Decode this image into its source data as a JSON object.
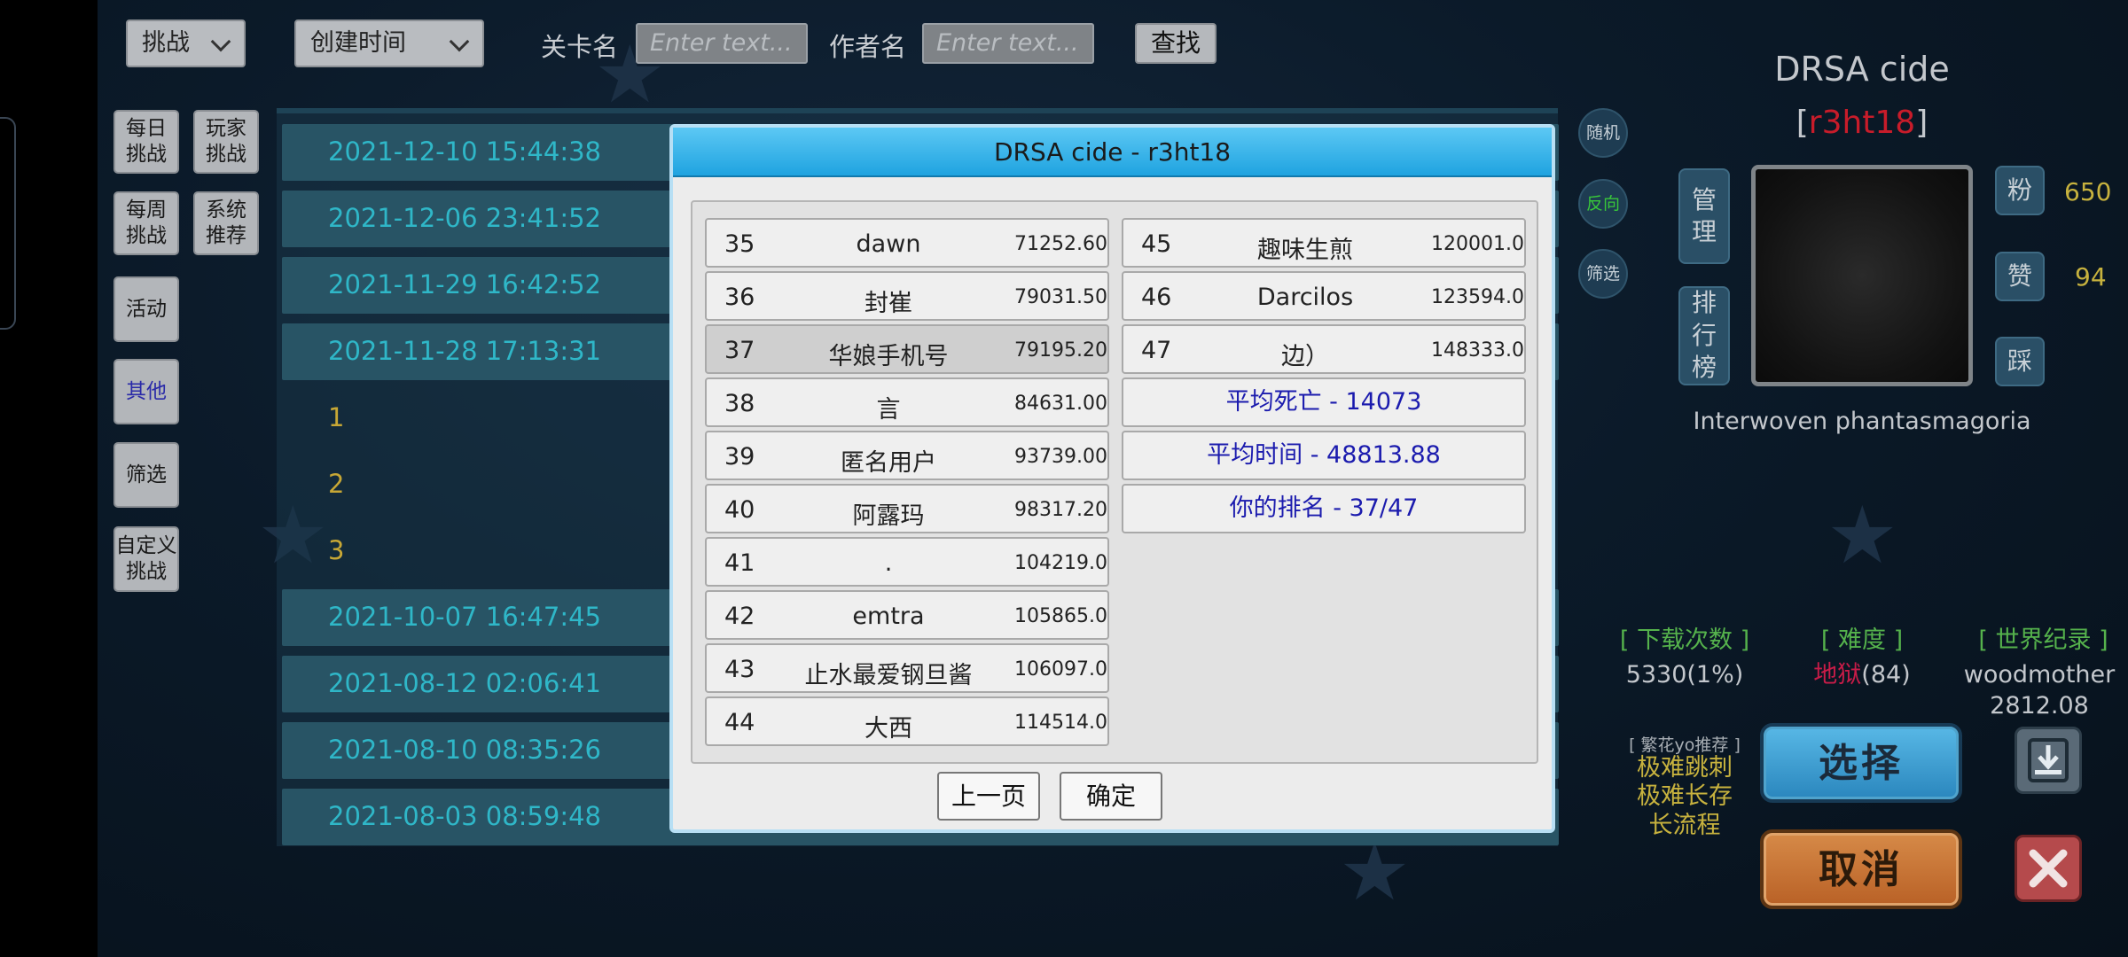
{
  "filters": {
    "type_select": "挑战",
    "sort_select": "创建时间",
    "level_name_label": "关卡名",
    "level_name_placeholder": "Enter text...",
    "author_label": "作者名",
    "author_placeholder": "Enter text...",
    "find_button": "查找"
  },
  "categories": [
    {
      "label": "每日挑战"
    },
    {
      "label": "玩家挑战"
    },
    {
      "label": "每周挑战"
    },
    {
      "label": "系统推荐"
    },
    {
      "label": "活动"
    },
    {
      "label": "其他"
    },
    {
      "label": "筛选"
    },
    {
      "label": "自定义挑战"
    }
  ],
  "list_rows": [
    "2021-12-10 15:44:38",
    "2021-12-06 23:41:52",
    "2021-11-29 16:42:52",
    "2021-11-28 17:13:31",
    "1",
    "2",
    "3",
    "2021-10-07 16:47:45",
    "2021-08-12 02:06:41",
    "2021-08-10 08:35:26",
    "2021-08-03 08:59:48"
  ],
  "side_round_buttons": [
    "随机",
    "反向",
    "筛选"
  ],
  "level": {
    "title": "DRSA cide",
    "author_open": "[",
    "author": "r3ht18",
    "author_close": "]",
    "manage_button": "管理",
    "leaderboard_button": "排行榜",
    "fans_label": "粉",
    "fans_value": "650",
    "likes_label": "赞",
    "likes_value": "94",
    "dislike_label": "踩",
    "description": "Interwoven phantasmagoria",
    "downloads_head": "[ 下载次数 ]",
    "downloads_value": "5330(1%)",
    "difficulty_head": "[ 难度 ]",
    "difficulty_word": "地狱",
    "difficulty_num": "(84)",
    "record_head": "[ 世界纪录 ]",
    "record_holder": "woodmother",
    "record_time": "2812.08",
    "recommend_head": "[ 繁花yo推荐 ]",
    "recommend_tags": [
      "极难跳刺",
      "极难长存",
      "长流程"
    ],
    "select_button": "选择",
    "cancel_button": "取消"
  },
  "modal": {
    "title": "DRSA cide - r3ht18",
    "left_rows": [
      {
        "rank": "35",
        "name": "dawn",
        "time": "71252.60"
      },
      {
        "rank": "36",
        "name": "封崔",
        "time": "79031.50"
      },
      {
        "rank": "37",
        "name": "华娘手机号",
        "time": "79195.20",
        "highlight": true
      },
      {
        "rank": "38",
        "name": "言",
        "time": "84631.00"
      },
      {
        "rank": "39",
        "name": "匿名用户",
        "time": "93739.00"
      },
      {
        "rank": "40",
        "name": "阿露玛",
        "time": "98317.20"
      },
      {
        "rank": "41",
        "name": ".",
        "time": "104219.0"
      },
      {
        "rank": "42",
        "name": "emtra",
        "time": "105865.0"
      },
      {
        "rank": "43",
        "name": "止水最爱钢旦酱",
        "time": "106097.0"
      },
      {
        "rank": "44",
        "name": "大西",
        "time": "114514.0"
      }
    ],
    "right_rows": [
      {
        "rank": "45",
        "name": "趣味生煎",
        "time": "120001.0"
      },
      {
        "rank": "46",
        "name": "Darcilos",
        "time": "123594.0"
      },
      {
        "rank": "47",
        "name": "边）",
        "time": "148333.0"
      }
    ],
    "avg_deaths": "平均死亡 - 14073",
    "avg_time": "平均时间 - 48813.88",
    "your_rank": "你的排名 - 37/47",
    "prev_button": "上一页",
    "ok_button": "确定"
  },
  "colors": {
    "accent_blue": "#1fa3e0",
    "list_text": "#2fb7c8",
    "gold": "#c7b23e",
    "red": "#c81c2a",
    "green_head": "#55b24c"
  }
}
